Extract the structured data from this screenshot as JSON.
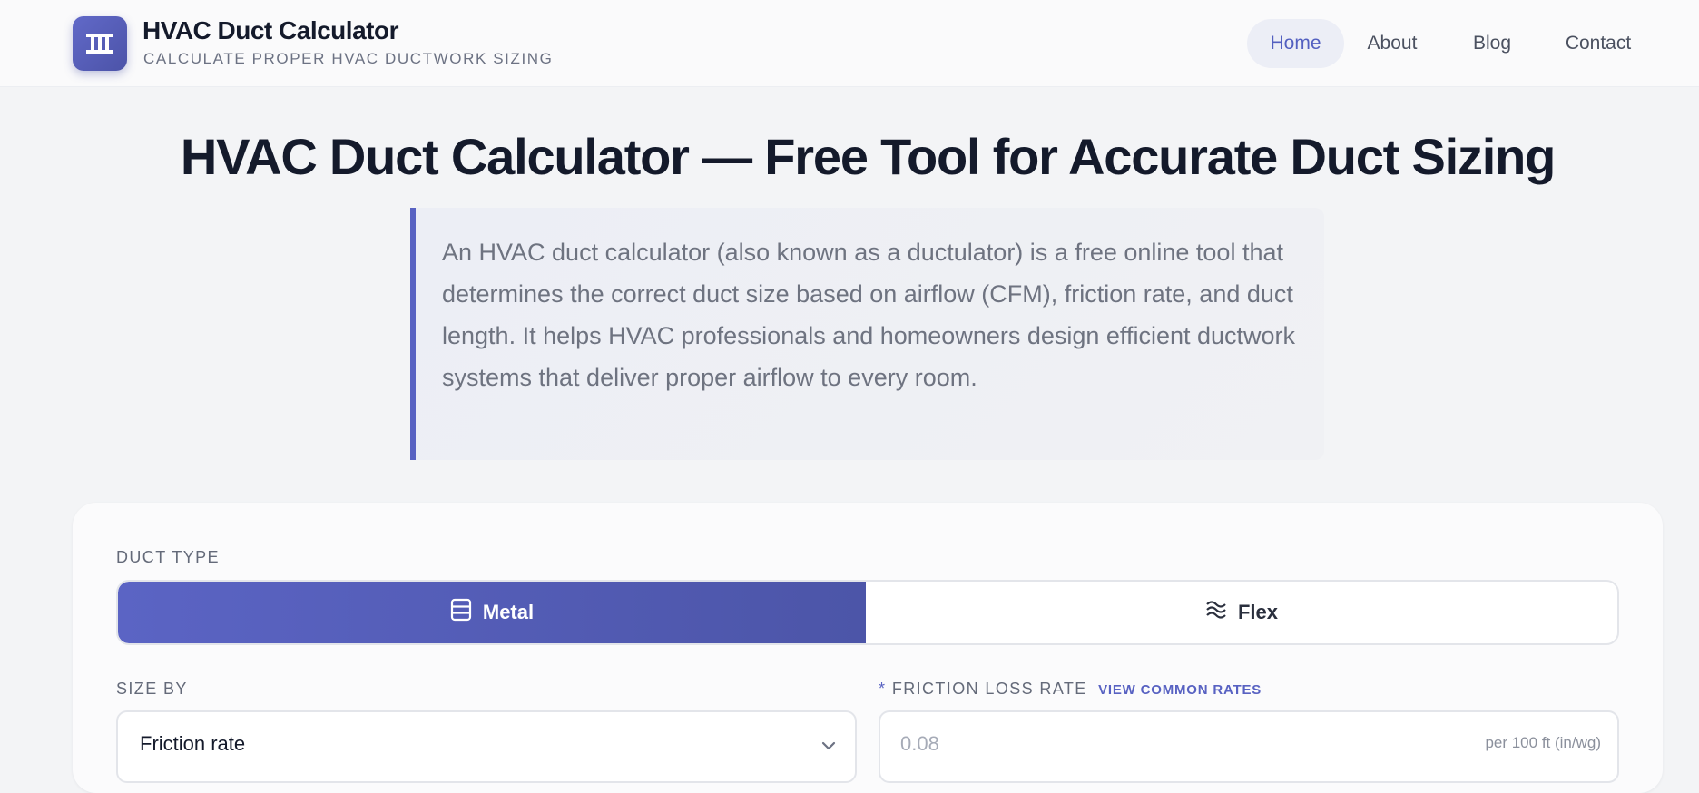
{
  "header": {
    "title": "HVAC Duct Calculator",
    "subtitle": "CALCULATE PROPER HVAC DUCTWORK SIZING",
    "logo_icon": "duct-icon"
  },
  "nav": {
    "items": [
      {
        "label": "Home",
        "active": true
      },
      {
        "label": "About",
        "active": false
      },
      {
        "label": "Blog",
        "active": false
      },
      {
        "label": "Contact",
        "active": false
      }
    ]
  },
  "hero": {
    "title": "HVAC Duct Calculator — Free Tool for Accurate Duct Sizing",
    "intro": "An HVAC duct calculator (also known as a ductulator) is a free online tool that determines the correct duct size based on airflow (CFM), friction rate, and duct length. It helps HVAC professionals and homeowners design efficient ductwork systems that deliver proper airflow to every room."
  },
  "form": {
    "duct_type_label": "DUCT TYPE",
    "duct_types": [
      {
        "label": "Metal",
        "icon": "metal-duct-icon",
        "selected": true
      },
      {
        "label": "Flex",
        "icon": "flex-duct-icon",
        "selected": false
      }
    ],
    "size_by_label": "SIZE BY",
    "size_by_value": "Friction rate",
    "friction": {
      "required_mark": "*",
      "label": "FRICTION LOSS RATE",
      "link": "VIEW COMMON RATES",
      "placeholder": "0.08",
      "unit": "per 100 ft (in/wg)"
    }
  },
  "colors": {
    "accent": "#5862c2",
    "background": "#f3f4f6",
    "text": "#141a2b"
  }
}
